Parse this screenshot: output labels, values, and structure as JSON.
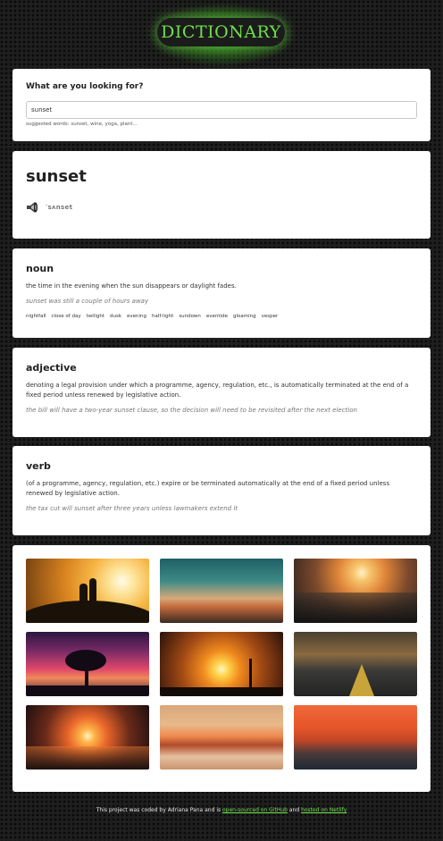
{
  "header": {
    "logo_text": "DICTIONARY"
  },
  "search": {
    "label": "What are you looking for?",
    "value": "sunset",
    "suggestions": "suggested words: sunset, wine, yoga, plant..."
  },
  "word": {
    "text": "sunset",
    "phonetic": "ˈsʌnset",
    "audio_icon": "speaker-icon"
  },
  "meanings": [
    {
      "part_of_speech": "noun",
      "definition": "the time in the evening when the sun disappears or daylight fades.",
      "example": "sunset was still a couple of hours away",
      "synonyms": [
        "nightfall",
        "close of day",
        "twilight",
        "dusk",
        "evening",
        "half-light",
        "sundown",
        "eventide",
        "gloaming",
        "vesper"
      ]
    },
    {
      "part_of_speech": "adjective",
      "definition": "denoting a legal provision under which a programme, agency, regulation, etc., is automatically terminated at the end of a fixed period unless renewed by legislative action.",
      "example": "the bill will have a two-year sunset clause, so the decision will need to be revisited after the next election"
    },
    {
      "part_of_speech": "verb",
      "definition": "(of a programme, agency, regulation, etc.) expire or be terminated automatically at the end of a fixed period unless renewed by legislative action.",
      "example": "the tax cut will sunset after three years unless lawmakers extend it"
    }
  ],
  "footer": {
    "text_before": "This project was coded by Adriana Pana and is ",
    "link_github": "open-sourced on GitHub",
    "text_middle": " and ",
    "link_netlify": "hosted on Netlify"
  },
  "colors": {
    "accent": "#6ee04a",
    "background": "#1f1f1f",
    "card": "#ffffff"
  }
}
